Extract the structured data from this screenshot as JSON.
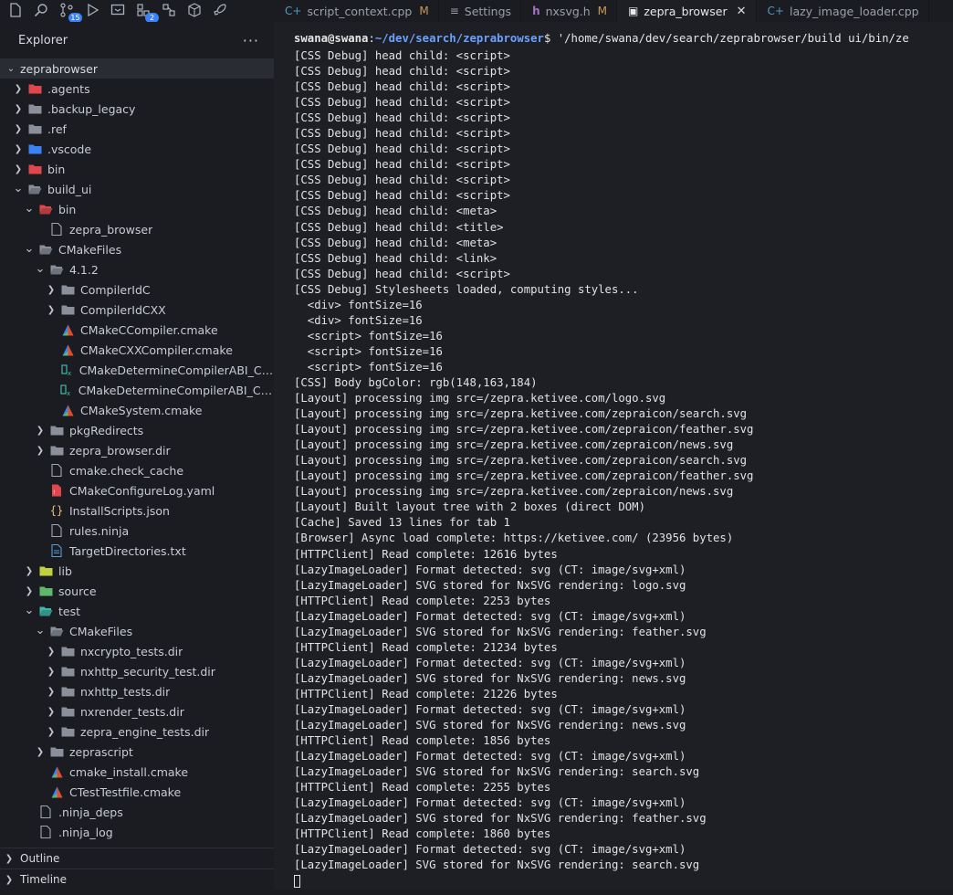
{
  "activity": {
    "icons": [
      "files-icon",
      "search-icon",
      "source-control-icon",
      "run-debug-icon",
      "remote-icon",
      "extensions-icon",
      "testing-icon",
      "database-icon",
      "deploy-icon"
    ],
    "badges": {
      "source_control": "15",
      "extensions": "2"
    }
  },
  "sidebar": {
    "title": "Explorer",
    "more": "···",
    "root": "zeprabrowser",
    "items": [
      {
        "label": ".agents",
        "depth": 0,
        "expanded": false,
        "kind": "folder",
        "color": "#e0474c"
      },
      {
        "label": ".backup_legacy",
        "depth": 0,
        "expanded": false,
        "kind": "folder",
        "color": "#8a8f99"
      },
      {
        "label": ".ref",
        "depth": 0,
        "expanded": false,
        "kind": "folder",
        "color": "#8a8f99"
      },
      {
        "label": ".vscode",
        "depth": 0,
        "expanded": false,
        "kind": "folder",
        "color": "#3b82f6"
      },
      {
        "label": "bin",
        "depth": 0,
        "expanded": false,
        "kind": "folder",
        "color": "#e0474c"
      },
      {
        "label": "build_ui",
        "depth": 0,
        "expanded": true,
        "kind": "folder",
        "color": "#8a8f99"
      },
      {
        "label": "bin",
        "depth": 1,
        "expanded": true,
        "kind": "folder",
        "color": "#e0474c"
      },
      {
        "label": "zepra_browser",
        "depth": 2,
        "expanded": null,
        "kind": "file",
        "color": "#a0a6b0"
      },
      {
        "label": "CMakeFiles",
        "depth": 1,
        "expanded": true,
        "kind": "folder",
        "color": "#8a8f99"
      },
      {
        "label": "4.1.2",
        "depth": 2,
        "expanded": true,
        "kind": "folder",
        "color": "#8a8f99"
      },
      {
        "label": "CompilerIdC",
        "depth": 3,
        "expanded": false,
        "kind": "folder",
        "color": "#8a8f99"
      },
      {
        "label": "CompilerIdCXX",
        "depth": 3,
        "expanded": false,
        "kind": "folder",
        "color": "#8a8f99"
      },
      {
        "label": "CMakeCCompiler.cmake",
        "depth": 3,
        "expanded": null,
        "kind": "cmake",
        "color": "#e34c26"
      },
      {
        "label": "CMakeCXXCompiler.cmake",
        "depth": 3,
        "expanded": null,
        "kind": "cmake",
        "color": "#e34c26"
      },
      {
        "label": "CMakeDetermineCompilerABI_C.bin",
        "depth": 3,
        "expanded": null,
        "kind": "bin",
        "color": "#3fb8a8"
      },
      {
        "label": "CMakeDetermineCompilerABI_CXX....",
        "depth": 3,
        "expanded": null,
        "kind": "bin",
        "color": "#3fb8a8"
      },
      {
        "label": "CMakeSystem.cmake",
        "depth": 3,
        "expanded": null,
        "kind": "cmake",
        "color": "#e34c26"
      },
      {
        "label": "pkgRedirects",
        "depth": 2,
        "expanded": false,
        "kind": "folder",
        "color": "#8a8f99"
      },
      {
        "label": "zepra_browser.dir",
        "depth": 2,
        "expanded": false,
        "kind": "folder",
        "color": "#8a8f99"
      },
      {
        "label": "cmake.check_cache",
        "depth": 2,
        "expanded": null,
        "kind": "file",
        "color": "#a0a6b0"
      },
      {
        "label": "CMakeConfigureLog.yaml",
        "depth": 2,
        "expanded": null,
        "kind": "yaml",
        "color": "#e0474c"
      },
      {
        "label": "InstallScripts.json",
        "depth": 2,
        "expanded": null,
        "kind": "json",
        "color": "#e5c07b"
      },
      {
        "label": "rules.ninja",
        "depth": 2,
        "expanded": null,
        "kind": "file",
        "color": "#a0a6b0"
      },
      {
        "label": "TargetDirectories.txt",
        "depth": 2,
        "expanded": null,
        "kind": "txt",
        "color": "#5b9bd5"
      },
      {
        "label": "lib",
        "depth": 1,
        "expanded": false,
        "kind": "folder",
        "color": "#c0d040"
      },
      {
        "label": "source",
        "depth": 1,
        "expanded": false,
        "kind": "folder",
        "color": "#5fb86b"
      },
      {
        "label": "test",
        "depth": 1,
        "expanded": true,
        "kind": "folder",
        "color": "#3fb8a8"
      },
      {
        "label": "CMakeFiles",
        "depth": 2,
        "expanded": true,
        "kind": "folder",
        "color": "#8a8f99"
      },
      {
        "label": "nxcrypto_tests.dir",
        "depth": 3,
        "expanded": false,
        "kind": "folder",
        "color": "#8a8f99"
      },
      {
        "label": "nxhttp_security_test.dir",
        "depth": 3,
        "expanded": false,
        "kind": "folder",
        "color": "#8a8f99"
      },
      {
        "label": "nxhttp_tests.dir",
        "depth": 3,
        "expanded": false,
        "kind": "folder",
        "color": "#8a8f99"
      },
      {
        "label": "nxrender_tests.dir",
        "depth": 3,
        "expanded": false,
        "kind": "folder",
        "color": "#8a8f99"
      },
      {
        "label": "zepra_engine_tests.dir",
        "depth": 3,
        "expanded": false,
        "kind": "folder",
        "color": "#8a8f99"
      },
      {
        "label": "zeprascript",
        "depth": 2,
        "expanded": false,
        "kind": "folder",
        "color": "#8a8f99"
      },
      {
        "label": "cmake_install.cmake",
        "depth": 2,
        "expanded": null,
        "kind": "cmake",
        "color": "#e34c26"
      },
      {
        "label": "CTestTestfile.cmake",
        "depth": 2,
        "expanded": null,
        "kind": "cmake",
        "color": "#e34c26"
      },
      {
        "label": ".ninja_deps",
        "depth": 1,
        "expanded": null,
        "kind": "file",
        "color": "#a0a6b0"
      },
      {
        "label": ".ninja_log",
        "depth": 1,
        "expanded": null,
        "kind": "file",
        "color": "#a0a6b0"
      }
    ],
    "sections": [
      "Outline",
      "Timeline"
    ]
  },
  "tabs": [
    {
      "label": "script_context.cpp",
      "icon": "C+",
      "icon_color": "#519aba",
      "modified": "M",
      "active": false
    },
    {
      "label": "Settings",
      "icon": "≡",
      "icon_color": "#9aa0a8",
      "modified": "",
      "active": false
    },
    {
      "label": "nxsvg.h",
      "icon": "h",
      "icon_color": "#a074c4",
      "modified": "M",
      "active": false
    },
    {
      "label": "zepra_browser",
      "icon": "▣",
      "icon_color": "#d7dae0",
      "modified": "",
      "active": true,
      "close": "✕"
    },
    {
      "label": "lazy_image_loader.cpp",
      "icon": "C+",
      "icon_color": "#519aba",
      "modified": "",
      "active": false
    }
  ],
  "terminal": {
    "prompt_user": "swana@swana",
    "prompt_sep": ":",
    "prompt_path": "~/dev/search/zeprabrowser",
    "prompt_cmd": "$ '/home/swana/dev/search/zeprabrowser/build ui/bin/ze",
    "lines": [
      "[CSS Debug] head child: <script>",
      "[CSS Debug] head child: <script>",
      "[CSS Debug] head child: <script>",
      "[CSS Debug] head child: <script>",
      "[CSS Debug] head child: <script>",
      "[CSS Debug] head child: <script>",
      "[CSS Debug] head child: <script>",
      "[CSS Debug] head child: <script>",
      "[CSS Debug] head child: <script>",
      "[CSS Debug] head child: <script>",
      "[CSS Debug] head child: <meta>",
      "[CSS Debug] head child: <title>",
      "[CSS Debug] head child: <meta>",
      "[CSS Debug] head child: <link>",
      "[CSS Debug] head child: <script>",
      "[CSS Debug] Stylesheets loaded, computing styles...",
      "  <div> fontSize=16",
      "  <div> fontSize=16",
      "  <script> fontSize=16",
      "  <script> fontSize=16",
      "  <script> fontSize=16",
      "[CSS] Body bgColor: rgb(148,163,184)",
      "[Layout] processing img src=/zepra.ketivee.com/logo.svg",
      "[Layout] processing img src=/zepra.ketivee.com/zepraicon/search.svg",
      "[Layout] processing img src=/zepra.ketivee.com/zepraicon/feather.svg",
      "[Layout] processing img src=/zepra.ketivee.com/zepraicon/news.svg",
      "[Layout] processing img src=/zepra.ketivee.com/zepraicon/search.svg",
      "[Layout] processing img src=/zepra.ketivee.com/zepraicon/feather.svg",
      "[Layout] processing img src=/zepra.ketivee.com/zepraicon/news.svg",
      "[Layout] Built layout tree with 2 boxes (direct DOM)",
      "[Cache] Saved 13 lines for tab 1",
      "[Browser] Async load complete: https://ketivee.com/ (23956 bytes)",
      "[HTTPClient] Read complete: 12616 bytes",
      "[LazyImageLoader] Format detected: svg (CT: image/svg+xml)",
      "[LazyImageLoader] SVG stored for NxSVG rendering: logo.svg",
      "[HTTPClient] Read complete: 2253 bytes",
      "[LazyImageLoader] Format detected: svg (CT: image/svg+xml)",
      "[LazyImageLoader] SVG stored for NxSVG rendering: feather.svg",
      "[HTTPClient] Read complete: 21234 bytes",
      "[LazyImageLoader] Format detected: svg (CT: image/svg+xml)",
      "[LazyImageLoader] SVG stored for NxSVG rendering: news.svg",
      "[HTTPClient] Read complete: 21226 bytes",
      "[LazyImageLoader] Format detected: svg (CT: image/svg+xml)",
      "[LazyImageLoader] SVG stored for NxSVG rendering: news.svg",
      "[HTTPClient] Read complete: 1856 bytes",
      "[LazyImageLoader] Format detected: svg (CT: image/svg+xml)",
      "[LazyImageLoader] SVG stored for NxSVG rendering: search.svg",
      "[HTTPClient] Read complete: 2255 bytes",
      "[LazyImageLoader] Format detected: svg (CT: image/svg+xml)",
      "[LazyImageLoader] SVG stored for NxSVG rendering: feather.svg",
      "[HTTPClient] Read complete: 1860 bytes",
      "[LazyImageLoader] Format detected: svg (CT: image/svg+xml)",
      "[LazyImageLoader] SVG stored for NxSVG rendering: search.svg"
    ]
  }
}
